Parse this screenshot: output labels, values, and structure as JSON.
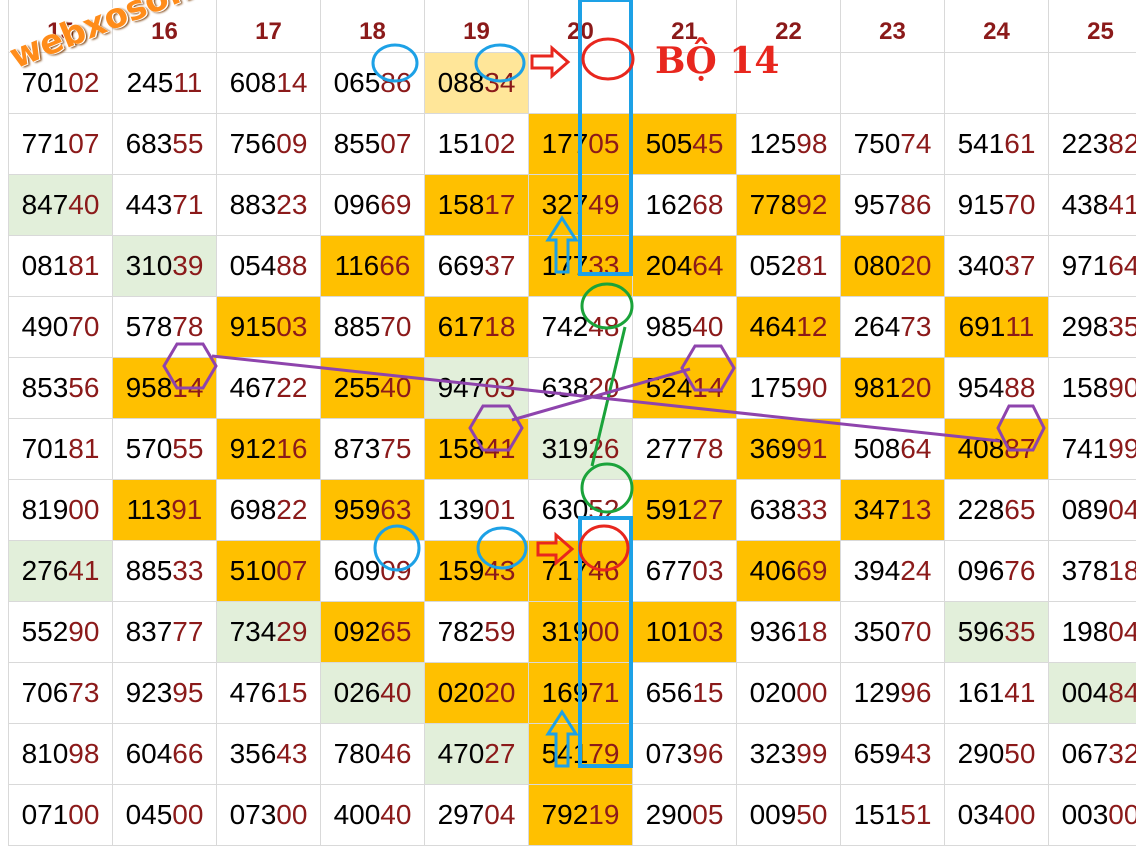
{
  "watermark": "webxoso.net",
  "label": "BỘ 14",
  "headers": [
    "15",
    "16",
    "17",
    "18",
    "19",
    "20",
    "21",
    "22",
    "23",
    "24",
    "25"
  ],
  "colors": {
    "orange": "#ffc000",
    "green": "#e2efda",
    "cream": "#ffe699",
    "blue": "#1da1e6",
    "red": "#e8271e",
    "purple": "#8e44ad",
    "darkgreen": "#1aa33a"
  },
  "rows": [
    [
      [
        "70102",
        ""
      ],
      [
        "24511",
        ""
      ],
      [
        "60814",
        ""
      ],
      [
        "06586",
        ""
      ],
      [
        "08834",
        "cream"
      ],
      [
        "",
        ""
      ],
      [
        "",
        ""
      ],
      [
        "",
        ""
      ],
      [
        "",
        ""
      ],
      [
        "",
        ""
      ],
      [
        "",
        ""
      ]
    ],
    [
      [
        "77107",
        ""
      ],
      [
        "68355",
        ""
      ],
      [
        "75609",
        ""
      ],
      [
        "85507",
        ""
      ],
      [
        "15102",
        ""
      ],
      [
        "17705",
        "orange"
      ],
      [
        "50545",
        "orange"
      ],
      [
        "12598",
        ""
      ],
      [
        "75074",
        ""
      ],
      [
        "54161",
        ""
      ],
      [
        "22382",
        ""
      ]
    ],
    [
      [
        "84740",
        "green"
      ],
      [
        "44371",
        ""
      ],
      [
        "88323",
        ""
      ],
      [
        "09669",
        ""
      ],
      [
        "15817",
        "orange"
      ],
      [
        "32749",
        "orange"
      ],
      [
        "16268",
        ""
      ],
      [
        "77892",
        "orange"
      ],
      [
        "95786",
        ""
      ],
      [
        "91570",
        ""
      ],
      [
        "43841",
        ""
      ]
    ],
    [
      [
        "08181",
        ""
      ],
      [
        "31039",
        "green"
      ],
      [
        "05488",
        ""
      ],
      [
        "11666",
        "orange"
      ],
      [
        "66937",
        ""
      ],
      [
        "17733",
        "orange"
      ],
      [
        "20464",
        "orange"
      ],
      [
        "05281",
        ""
      ],
      [
        "08020",
        "orange"
      ],
      [
        "34037",
        ""
      ],
      [
        "97164",
        ""
      ]
    ],
    [
      [
        "49070",
        ""
      ],
      [
        "57878",
        ""
      ],
      [
        "91503",
        "orange"
      ],
      [
        "88570",
        ""
      ],
      [
        "61718",
        "orange"
      ],
      [
        "74248",
        ""
      ],
      [
        "98540",
        ""
      ],
      [
        "46412",
        "orange"
      ],
      [
        "26473",
        ""
      ],
      [
        "69111",
        "orange"
      ],
      [
        "29835",
        ""
      ]
    ],
    [
      [
        "85356",
        ""
      ],
      [
        "95814",
        "orange"
      ],
      [
        "46722",
        ""
      ],
      [
        "25540",
        "orange"
      ],
      [
        "94703",
        "green"
      ],
      [
        "63820",
        ""
      ],
      [
        "52414",
        "orange"
      ],
      [
        "17590",
        ""
      ],
      [
        "98120",
        "orange"
      ],
      [
        "95488",
        ""
      ],
      [
        "15890",
        ""
      ]
    ],
    [
      [
        "70181",
        ""
      ],
      [
        "57055",
        ""
      ],
      [
        "91216",
        "orange"
      ],
      [
        "87375",
        ""
      ],
      [
        "15841",
        "orange"
      ],
      [
        "31926",
        "green"
      ],
      [
        "27778",
        ""
      ],
      [
        "36991",
        "orange"
      ],
      [
        "50864",
        ""
      ],
      [
        "40887",
        "orange"
      ],
      [
        "74199",
        ""
      ]
    ],
    [
      [
        "81900",
        ""
      ],
      [
        "11391",
        "orange"
      ],
      [
        "69822",
        ""
      ],
      [
        "95963",
        "orange"
      ],
      [
        "13901",
        ""
      ],
      [
        "63052",
        ""
      ],
      [
        "59127",
        "orange"
      ],
      [
        "63833",
        ""
      ],
      [
        "34713",
        "orange"
      ],
      [
        "22865",
        ""
      ],
      [
        "08904",
        ""
      ]
    ],
    [
      [
        "27641",
        "green"
      ],
      [
        "88533",
        ""
      ],
      [
        "51007",
        "orange"
      ],
      [
        "60909",
        ""
      ],
      [
        "15943",
        "orange"
      ],
      [
        "71746",
        "orange"
      ],
      [
        "67703",
        ""
      ],
      [
        "40669",
        "orange"
      ],
      [
        "39424",
        ""
      ],
      [
        "09676",
        ""
      ],
      [
        "37818",
        ""
      ]
    ],
    [
      [
        "55290",
        ""
      ],
      [
        "83777",
        ""
      ],
      [
        "73429",
        "green"
      ],
      [
        "09265",
        "orange"
      ],
      [
        "78259",
        ""
      ],
      [
        "31900",
        "orange"
      ],
      [
        "10103",
        "orange"
      ],
      [
        "93618",
        ""
      ],
      [
        "35070",
        ""
      ],
      [
        "59635",
        "green"
      ],
      [
        "19804",
        ""
      ]
    ],
    [
      [
        "70673",
        ""
      ],
      [
        "92395",
        ""
      ],
      [
        "47615",
        ""
      ],
      [
        "02640",
        "green"
      ],
      [
        "02020",
        "orange"
      ],
      [
        "16971",
        "orange"
      ],
      [
        "65615",
        ""
      ],
      [
        "02000",
        ""
      ],
      [
        "12996",
        ""
      ],
      [
        "16141",
        ""
      ],
      [
        "00484",
        "green"
      ]
    ],
    [
      [
        "81098",
        ""
      ],
      [
        "60466",
        ""
      ],
      [
        "35643",
        ""
      ],
      [
        "78046",
        ""
      ],
      [
        "47027",
        "green"
      ],
      [
        "54179",
        "orange"
      ],
      [
        "07396",
        ""
      ],
      [
        "32399",
        ""
      ],
      [
        "65943",
        ""
      ],
      [
        "29050",
        ""
      ],
      [
        "06732",
        ""
      ]
    ],
    [
      [
        "07100",
        ""
      ],
      [
        "04500",
        ""
      ],
      [
        "07300",
        ""
      ],
      [
        "40040",
        ""
      ],
      [
        "29704",
        ""
      ],
      [
        "79219",
        "orange"
      ],
      [
        "29005",
        ""
      ],
      [
        "00950",
        ""
      ],
      [
        "15151",
        ""
      ],
      [
        "03400",
        ""
      ],
      [
        "00300",
        ""
      ]
    ]
  ]
}
